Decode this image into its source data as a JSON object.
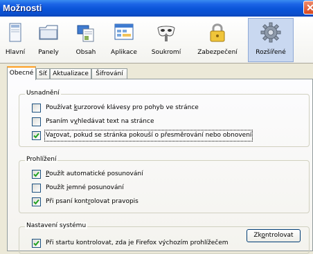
{
  "window": {
    "title": "Možnosti"
  },
  "toolbar": {
    "items": [
      {
        "label": "Hlavní",
        "icon": "main-window-icon"
      },
      {
        "label": "Panely",
        "icon": "tabs-folder-icon"
      },
      {
        "label": "Obsah",
        "icon": "content-document-icon"
      },
      {
        "label": "Aplikace",
        "icon": "applications-icon"
      },
      {
        "label": "Soukromí",
        "icon": "privacy-mask-icon"
      },
      {
        "label": "Zabezpečení",
        "icon": "security-lock-icon"
      },
      {
        "label": "Rozšířené",
        "icon": "advanced-gear-icon"
      }
    ],
    "active": "Rozšířené"
  },
  "tabs": [
    "Obecné",
    "Síť",
    "Aktualizace",
    "Šifrování"
  ],
  "active_tab": "Obecné",
  "groups": {
    "accessibility": {
      "legend": "Usnadnění",
      "opts": [
        {
          "pre": "Používat ",
          "ul": "k",
          "post": "urzorové klávesy pro pohyb ve stránce",
          "checked": false
        },
        {
          "pre": "Psaním v",
          "ul": "y",
          "post": "hledávat text na stránce",
          "checked": false
        },
        {
          "pre": "Va",
          "ul": "r",
          "post": "ovat, pokud se stránka pokouší o přesměrování nebo obnovení",
          "checked": true
        }
      ]
    },
    "browsing": {
      "legend": "Prohlížení",
      "opts": [
        {
          "pre": "",
          "ul": "P",
          "post": "oužít automatické posunování",
          "checked": true
        },
        {
          "pre": "Použít ",
          "ul": "j",
          "post": "emné posunování",
          "checked": false
        },
        {
          "pre": "Při psaní kont",
          "ul": "r",
          "post": "olovat pravopis",
          "checked": true
        }
      ]
    },
    "system": {
      "legend": "Nastavení systému",
      "opts": [
        {
          "pre": "Při startu kontrolovat, zda je Firefox výchozím prohlížečem",
          "ul": "",
          "post": "",
          "checked": true
        }
      ],
      "button": {
        "pre": "Zk",
        "ul": "o",
        "post": "ntrolovat"
      }
    }
  },
  "colors": {
    "title_bar": "#0a54d8",
    "close": "#d8471f",
    "focus_tab": "#ff9e20",
    "check": "#21a121"
  }
}
